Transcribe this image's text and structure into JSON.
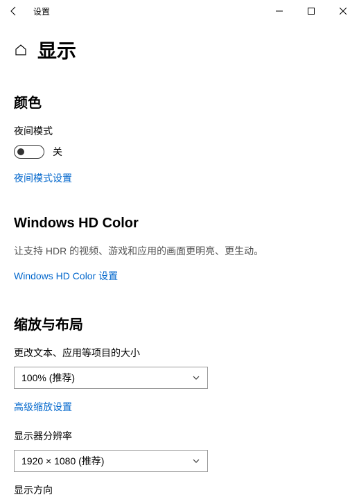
{
  "titlebar": {
    "app_name": "设置"
  },
  "header": {
    "page_title": "显示"
  },
  "color_section": {
    "heading": "颜色",
    "night_mode_label": "夜间模式",
    "night_mode_state": "关",
    "night_mode_link": "夜间模式设置"
  },
  "hdr_section": {
    "heading": "Windows HD Color",
    "description": "让支持 HDR 的视频、游戏和应用的画面更明亮、更生动。",
    "link": "Windows HD Color 设置"
  },
  "scale_section": {
    "heading": "缩放与布局",
    "text_size_label": "更改文本、应用等项目的大小",
    "text_size_value": "100% (推荐)",
    "advanced_link": "高级缩放设置",
    "resolution_label": "显示器分辨率",
    "resolution_value": "1920 × 1080 (推荐)",
    "orientation_label": "显示方向"
  }
}
